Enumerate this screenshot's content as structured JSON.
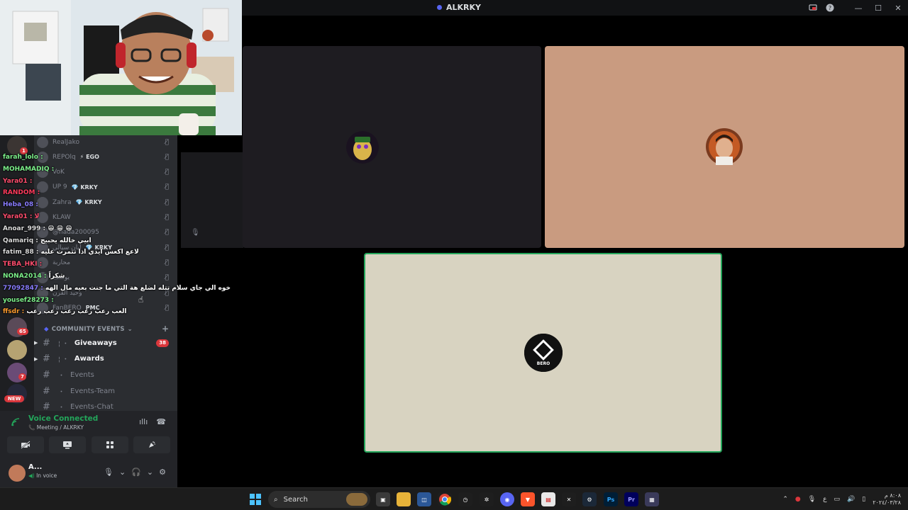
{
  "window": {
    "title": "ALKRKY",
    "controls": {
      "minimize": "—",
      "maximize": "☐",
      "close": "✕"
    },
    "icons": [
      "screen-share-icon",
      "help-icon"
    ]
  },
  "voice_members": [
    {
      "name": "RealJako",
      "tag": ""
    },
    {
      "name": "REPOlq",
      "tag": "⚡ EGO"
    },
    {
      "name": "VoK",
      "tag": ""
    },
    {
      "name": "UP 9",
      "tag": "💎 KRKY"
    },
    {
      "name": "Zahra",
      "tag": "💎 KRKY"
    },
    {
      "name": "KLAW",
      "tag": ""
    },
    {
      "name": "@nada200095",
      "tag": ""
    },
    {
      "name": "ليان سيالي",
      "tag": "💎 KRKY"
    },
    {
      "name": "محاربة",
      "tag": ""
    },
    {
      "name": "يوسف",
      "tag": ""
    },
    {
      "name": "وحيد القرن",
      "tag": ""
    },
    {
      "name": "FanBERO",
      "tag": "PMC"
    }
  ],
  "chat": [
    {
      "user": "farah_lolo :",
      "color": "#7cf08a",
      "msg": ""
    },
    {
      "user": "MOHAMADIQ :",
      "color": "#7cf08a",
      "msg": ""
    },
    {
      "user": "Yara01 :",
      "color": "#ff4d6d",
      "msg": ""
    },
    {
      "user": "RANDOM :",
      "color": "#ff3b5c",
      "msg": ""
    },
    {
      "user": "Heba_08 :",
      "color": "#8a7dff",
      "msg": ""
    },
    {
      "user": "Yara01 : لا",
      "color": "#ff4d6d",
      "msg": ""
    },
    {
      "user": "Anoar_999 :",
      "color": "#dcdcdc",
      "msg": "😁 😁 😁"
    },
    {
      "user": "Qamariq :",
      "color": "#dcdcdc",
      "msg": "ابيي خالله يحبيج"
    },
    {
      "user": "fatim_88 :",
      "color": "#dcdcdc",
      "msg": "لاعع اكعس ايدي اذا تتمرت عليه"
    },
    {
      "user": "TEBA_HKI :",
      "color": "#ff4d6d",
      "msg": ""
    },
    {
      "user": "NONA2014 :",
      "color": "#7cf08a",
      "msg": "شكراً"
    },
    {
      "user": "77092847 :",
      "color": "#8a7dff",
      "msg": "خوه الي جاي سلام تتله لضلع هة التي ما جنت بعيه مال الهه"
    },
    {
      "user": "yousef28273 :",
      "color": "#7cf08a",
      "msg": ""
    },
    {
      "user": "ffsdr :",
      "color": "#ff9d2e",
      "msg": "العب رعب رعب رعب رعب رعب"
    }
  ],
  "rail_badges": [
    "1",
    "65",
    "7"
  ],
  "new_label": "NEW",
  "category": {
    "label": "COMMUNITY EVENTS",
    "add": "+"
  },
  "channels": [
    {
      "name": "Giveaways",
      "prefix": "¦ ・",
      "unread": true,
      "badge": "38"
    },
    {
      "name": "Awards",
      "prefix": "¦ ・",
      "unread": true,
      "badge": ""
    },
    {
      "name": "Events",
      "prefix": "・",
      "unread": false,
      "badge": ""
    },
    {
      "name": "Events-Team",
      "prefix": "・",
      "unread": false,
      "badge": ""
    },
    {
      "name": "Events-Chat",
      "prefix": "・",
      "unread": false,
      "badge": ""
    }
  ],
  "voice": {
    "status": "Voice Connected",
    "location": "Meeting / ALKRKY"
  },
  "user": {
    "name": "A...",
    "status": "In voice"
  },
  "tiles": {
    "top_left_bg": "#1e1c21",
    "top_right_bg": "#c99b80",
    "bottom_bg": "#d8d3c1",
    "speaking_color": "#23a55a",
    "bottom_avatar_label": "BERO"
  },
  "taskbar": {
    "search_label": "Search",
    "lang": "ع",
    "time": "٨:٠٨ م",
    "date": "٢٠٢٤/٠٣/٢٨"
  }
}
